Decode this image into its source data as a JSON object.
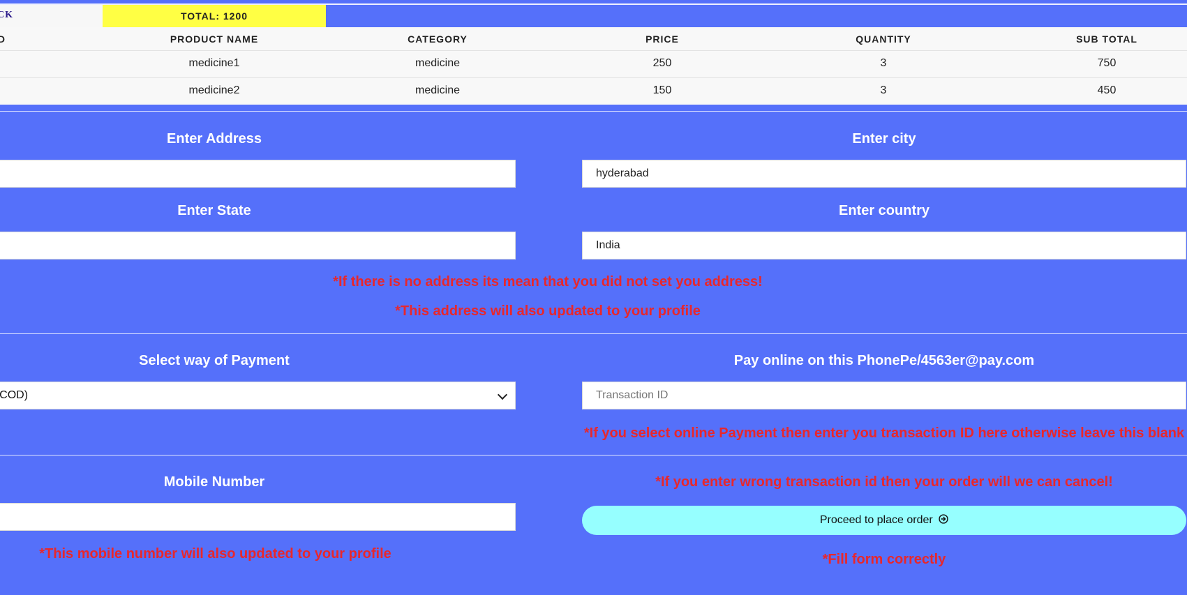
{
  "header": {
    "back_label": "BACK",
    "total_label": "TOTAL: 1200"
  },
  "table": {
    "columns": [
      "ID",
      "PRODUCT NAME",
      "CATEGORY",
      "PRICE",
      "QUANTITY",
      "SUB TOTAL"
    ],
    "rows": [
      {
        "product": "medicine1",
        "category": "medicine",
        "price": "250",
        "quantity": "3",
        "subtotal": "750"
      },
      {
        "product": "medicine2",
        "category": "medicine",
        "price": "150",
        "quantity": "3",
        "subtotal": "450"
      }
    ]
  },
  "address": {
    "address_label": "Enter Address",
    "address_value": "",
    "city_label": "Enter city",
    "city_value": "hyderabad",
    "state_label": "Enter State",
    "state_value": "",
    "country_label": "Enter country",
    "country_value": "India",
    "warning_no_address": "*If there is no address its mean that you did not set you address!",
    "warning_profile": "*This address will also updated to your profile"
  },
  "payment": {
    "label": "Select way of Payment",
    "selected": "Cash on Delivery(COD)",
    "online_label": "Pay online on this PhonePe/4563er@pay.com",
    "transaction_placeholder": "Transaction ID",
    "transaction_warning": "*If you select online Payment then enter you transaction ID here otherwise leave this blank"
  },
  "contact": {
    "mobile_label": "Mobile Number",
    "mobile_value": "",
    "mobile_warning": "*This mobile number will also updated to your profile",
    "wrong_tx_warning": "*If you enter wrong transaction id then your order will we can cancel!",
    "proceed_label": "Proceed to place order",
    "fill_warning": "*Fill form correctly"
  },
  "icons": {
    "proceed_icon": "circle-arrow-right-icon",
    "select_icon": "chevron-down-icon"
  },
  "colors": {
    "background": "#5570fa",
    "total_bg": "#ffff44",
    "warning": "#e8272c",
    "button": "#96ffff"
  }
}
